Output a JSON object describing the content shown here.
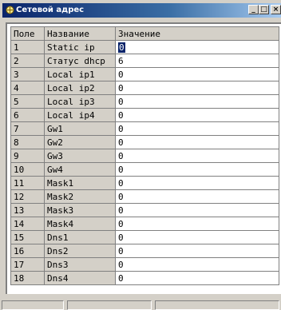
{
  "window": {
    "title": "Сетевой адрес"
  },
  "titlebar_buttons": {
    "minimize": "_",
    "maximize": "□",
    "close": "×"
  },
  "grid": {
    "headers": [
      "Поле",
      "Название",
      "Значение"
    ],
    "rows": [
      [
        "1",
        "Static ip",
        "0"
      ],
      [
        "2",
        "Статус dhcp",
        "6"
      ],
      [
        "3",
        "Local ip1",
        "0"
      ],
      [
        "4",
        "Local ip2",
        "0"
      ],
      [
        "5",
        "Local ip3",
        "0"
      ],
      [
        "6",
        "Local ip4",
        "0"
      ],
      [
        "7",
        "Gw1",
        "0"
      ],
      [
        "8",
        "Gw2",
        "0"
      ],
      [
        "9",
        "Gw3",
        "0"
      ],
      [
        "10",
        "Gw4",
        "0"
      ],
      [
        "11",
        "Mask1",
        "0"
      ],
      [
        "12",
        "Mask2",
        "0"
      ],
      [
        "13",
        "Mask3",
        "0"
      ],
      [
        "14",
        "Mask4",
        "0"
      ],
      [
        "15",
        "Dns1",
        "0"
      ],
      [
        "16",
        "Dns2",
        "0"
      ],
      [
        "17",
        "Dns3",
        "0"
      ],
      [
        "18",
        "Dns4",
        "0"
      ]
    ]
  },
  "icons": {
    "app": "network-app-icon"
  }
}
